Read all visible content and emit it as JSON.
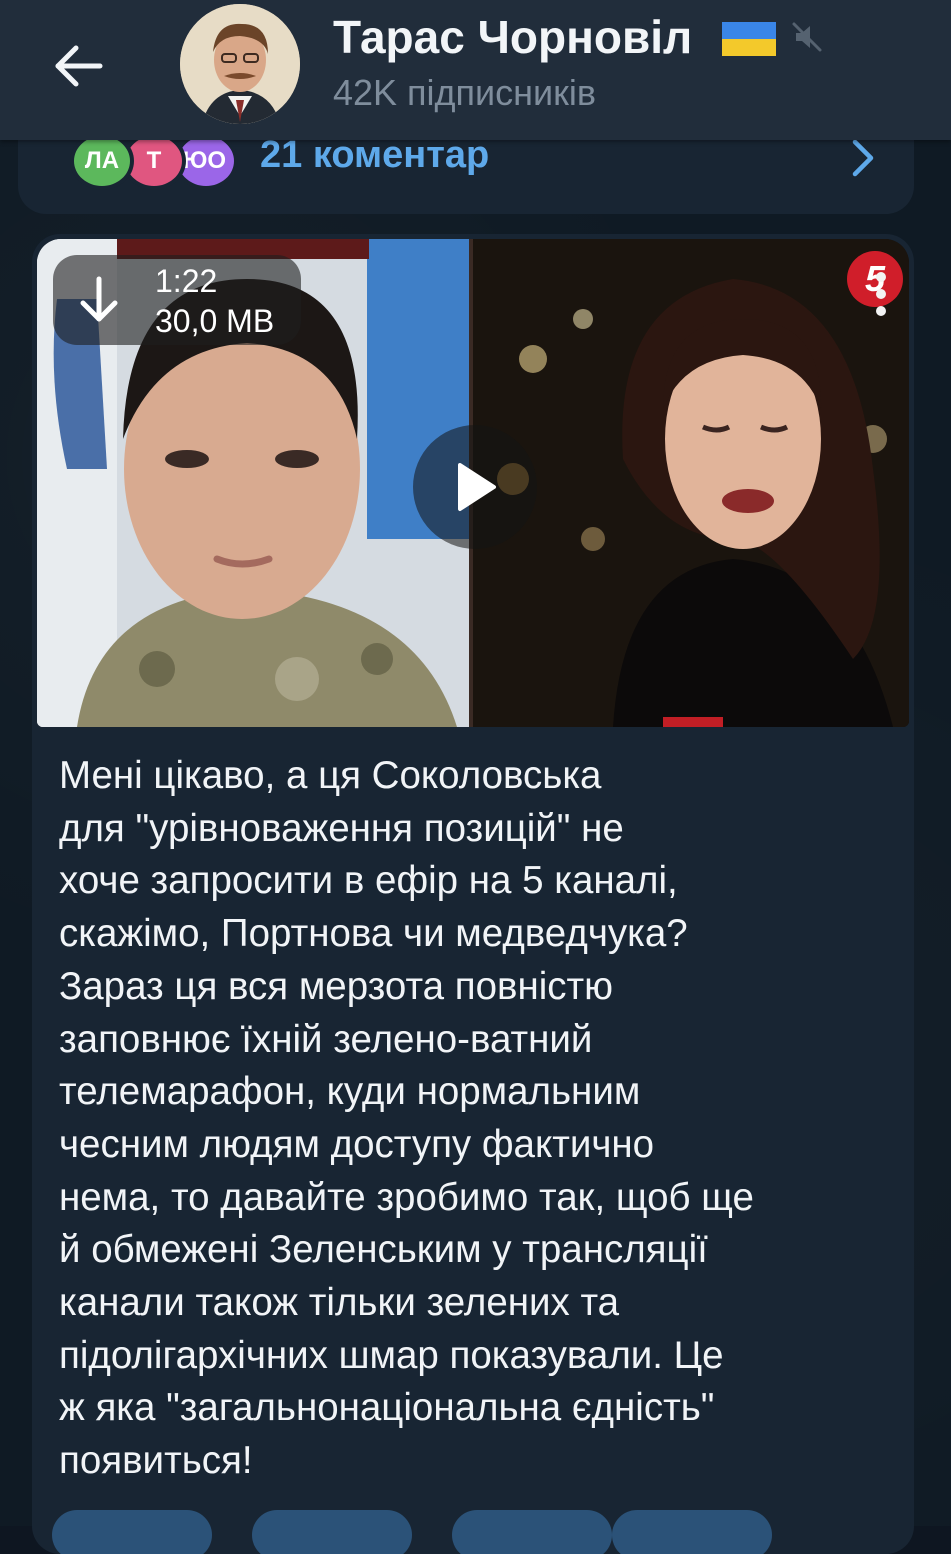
{
  "header": {
    "channel_name": "Тарас Чорновіл",
    "subscribers": "42K підписників",
    "flag": "ukraine-flag-icon",
    "muted": true
  },
  "previous_post": {
    "comment_avatars": [
      {
        "initials": "ЛА",
        "color": "#5cb85c"
      },
      {
        "initials": "Т",
        "color": "#e05680"
      },
      {
        "initials": "ЮО",
        "color": "#9b66e8"
      }
    ],
    "comments_label": "21 коментар"
  },
  "video": {
    "duration": "1:22",
    "file_size": "30,0 MB",
    "channel_logo": "5"
  },
  "post": {
    "text": "Мені цікаво, а ця Соколовська\nдля \"урівноваження позицій\" не\nхоче запросити в ефір на 5 каналі,\nскажімо, Портнова чи медведчука?\nЗараз ця вся мерзота повністю\nзаповнює їхній зелено-ватний\nтелемарафон, куди нормальним\nчесним людям доступу фактично\nнема, то давайте зробимо так, щоб ще\nй обмежені Зеленським у трансляції\nканали також тільки зелених та\nпідолігархічних шмар показували. Це\nж яка \"загальнонаціональна єдність\"\nпоявиться!"
  },
  "colors": {
    "header_bg": "#212d3b",
    "bubble_bg": "#182533",
    "link_blue": "#5ea9ea"
  }
}
